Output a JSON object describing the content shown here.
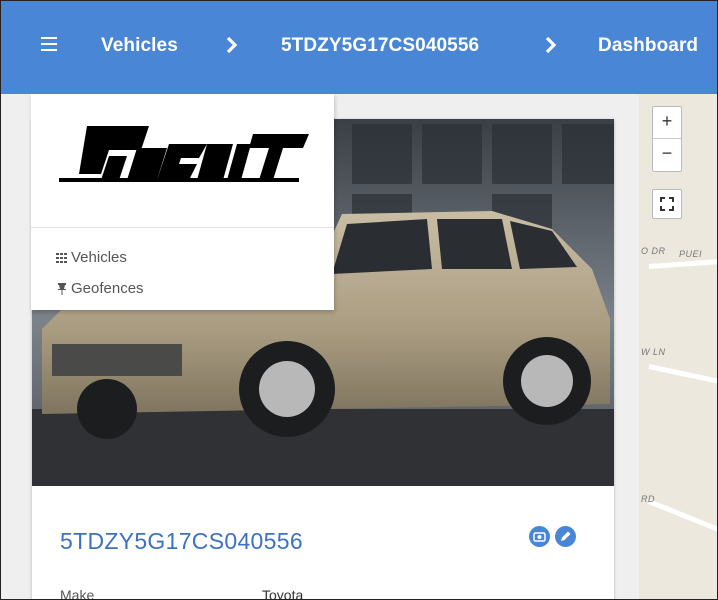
{
  "breadcrumb": {
    "items": [
      {
        "label": "Vehicles"
      },
      {
        "label": "5TDZY5G17CS040556"
      },
      {
        "label": "Dashboard"
      }
    ]
  },
  "menu": {
    "logo_text": "Pursuit",
    "items": [
      {
        "label": "Vehicles",
        "icon": "grid-icon"
      },
      {
        "label": "Geofences",
        "icon": "pin-icon"
      }
    ]
  },
  "map": {
    "zoom_in": "+",
    "zoom_out": "−",
    "labels": [
      "O DR",
      "PUEI",
      "W LN",
      "RD"
    ]
  },
  "vehicle": {
    "vin": "5TDZY5G17CS040556",
    "fields": [
      {
        "label": "Make",
        "value": "Toyota"
      }
    ]
  },
  "colors": {
    "accent": "#4a86d6",
    "title": "#3d72c0"
  }
}
